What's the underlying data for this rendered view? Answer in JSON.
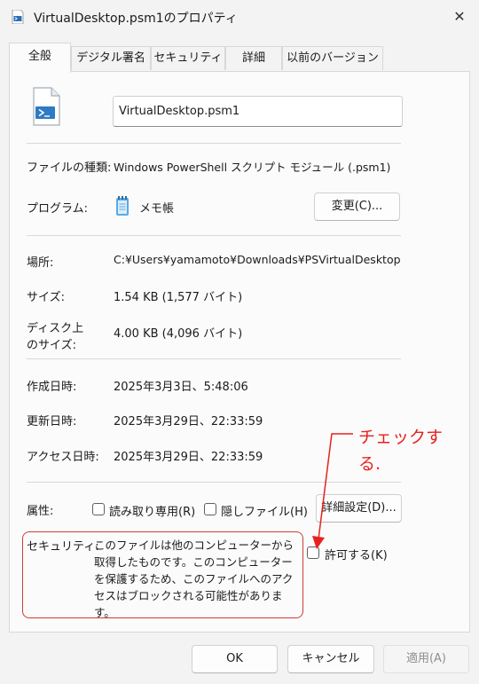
{
  "window": {
    "title": "VirtualDesktop.psm1のプロパティ",
    "close_glyph": "✕"
  },
  "tabs": [
    "全般",
    "デジタル署名",
    "セキュリティ",
    "詳細",
    "以前のバージョン"
  ],
  "file": {
    "name": "VirtualDesktop.psm1"
  },
  "info": {
    "type_label": "ファイルの種類:",
    "type_value": "Windows PowerShell スクリプト モジュール (.psm1)",
    "program_label": "プログラム:",
    "program_value": "メモ帳",
    "change_button": "変更(C)...",
    "location_label": "場所:",
    "location_value": "C:¥Users¥yamamoto¥Downloads¥PSVirtualDesktop",
    "size_label": "サイズ:",
    "size_value": "1.54 KB (1,577 バイト)",
    "disk_label_1": "ディスク上",
    "disk_label_2": "のサイズ:",
    "disk_value": "4.00 KB (4,096 バイト)",
    "created_label": "作成日時:",
    "created_value": "2025年3月3日、5:48:06",
    "modified_label": "更新日時:",
    "modified_value": "2025年3月29日、22:33:59",
    "accessed_label": "アクセス日時:",
    "accessed_value": "2025年3月29日、22:33:59"
  },
  "attributes": {
    "label": "属性:",
    "readonly": "読み取り専用(R)",
    "hidden": "隠しファイル(H)",
    "advanced_button": "詳細設定(D)...",
    "readonly_checked": false,
    "hidden_checked": false
  },
  "security": {
    "label": "セキュリティ:",
    "text": "このファイルは他のコンピューターから取得したものです。このコンピューターを保護するため、このファイルへのアクセスはブロックされる可能性があります。",
    "unblock_label": "許可する(K)",
    "unblock_checked": false
  },
  "annotation": {
    "text": "チェックする.",
    "color": "#e8211c"
  },
  "buttons": {
    "ok": "OK",
    "cancel": "キャンセル",
    "apply": "適用(A)"
  },
  "colors": {
    "window_bg": "#f3f3f3",
    "panel_bg": "#fbfbfb",
    "annotation_red": "#e8211c",
    "box_red": "#d03a3a"
  },
  "icons": {
    "file": "powershell-file-icon",
    "program": "notepad-icon",
    "title": "powershell-file-icon"
  }
}
